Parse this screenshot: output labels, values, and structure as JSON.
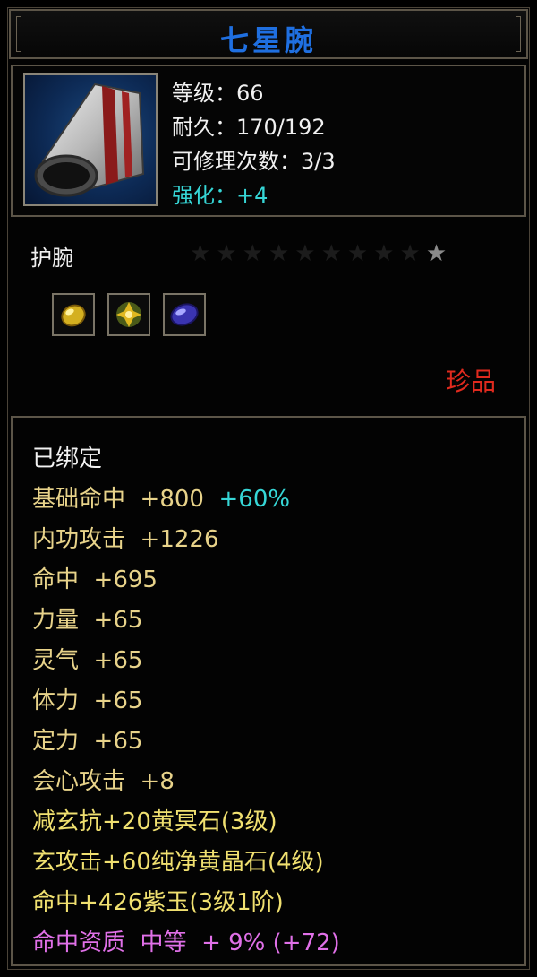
{
  "item": {
    "name": "七星腕",
    "level_line": "等级：66",
    "durability_line": "耐久：170/192",
    "repair_line": "可修理次数：3/3",
    "enhance_line": "强化：+4",
    "type": "护腕",
    "rarity": "珍品",
    "rarity_color": "#e02a1e"
  },
  "stars": {
    "total": 10,
    "lit": 1
  },
  "gems": [
    {
      "name": "gold-gem-icon",
      "color": "#d4b020"
    },
    {
      "name": "yellow-crystal-gem-icon",
      "color": "#c8a020"
    },
    {
      "name": "purple-jade-gem-icon",
      "color": "#4a40c8"
    }
  ],
  "attributes": {
    "bound": "已绑定",
    "base_hit_label": "基础命中",
    "base_hit_value": "+800",
    "base_hit_bonus": "+60%",
    "inner_attack_label": "内功攻击",
    "inner_attack_value": "+1226",
    "hit_label": "命中",
    "hit_value": "+695",
    "strength_label": "力量",
    "strength_value": "+65",
    "spirit_label": "灵气",
    "spirit_value": "+65",
    "stamina_label": "体力",
    "stamina_value": "+65",
    "focus_label": "定力",
    "focus_value": "+65",
    "crit_label": "会心攻击",
    "crit_value": "+8",
    "gem_line_1": "减玄抗+20黄冥石(3级)",
    "gem_line_2": "玄攻击+60纯净黄晶石(4级)",
    "gem_line_3": "命中+426紫玉(3级1阶)",
    "quality_label": "命中资质",
    "quality_grade": "中等",
    "quality_value": "+ 9% (+72)"
  }
}
